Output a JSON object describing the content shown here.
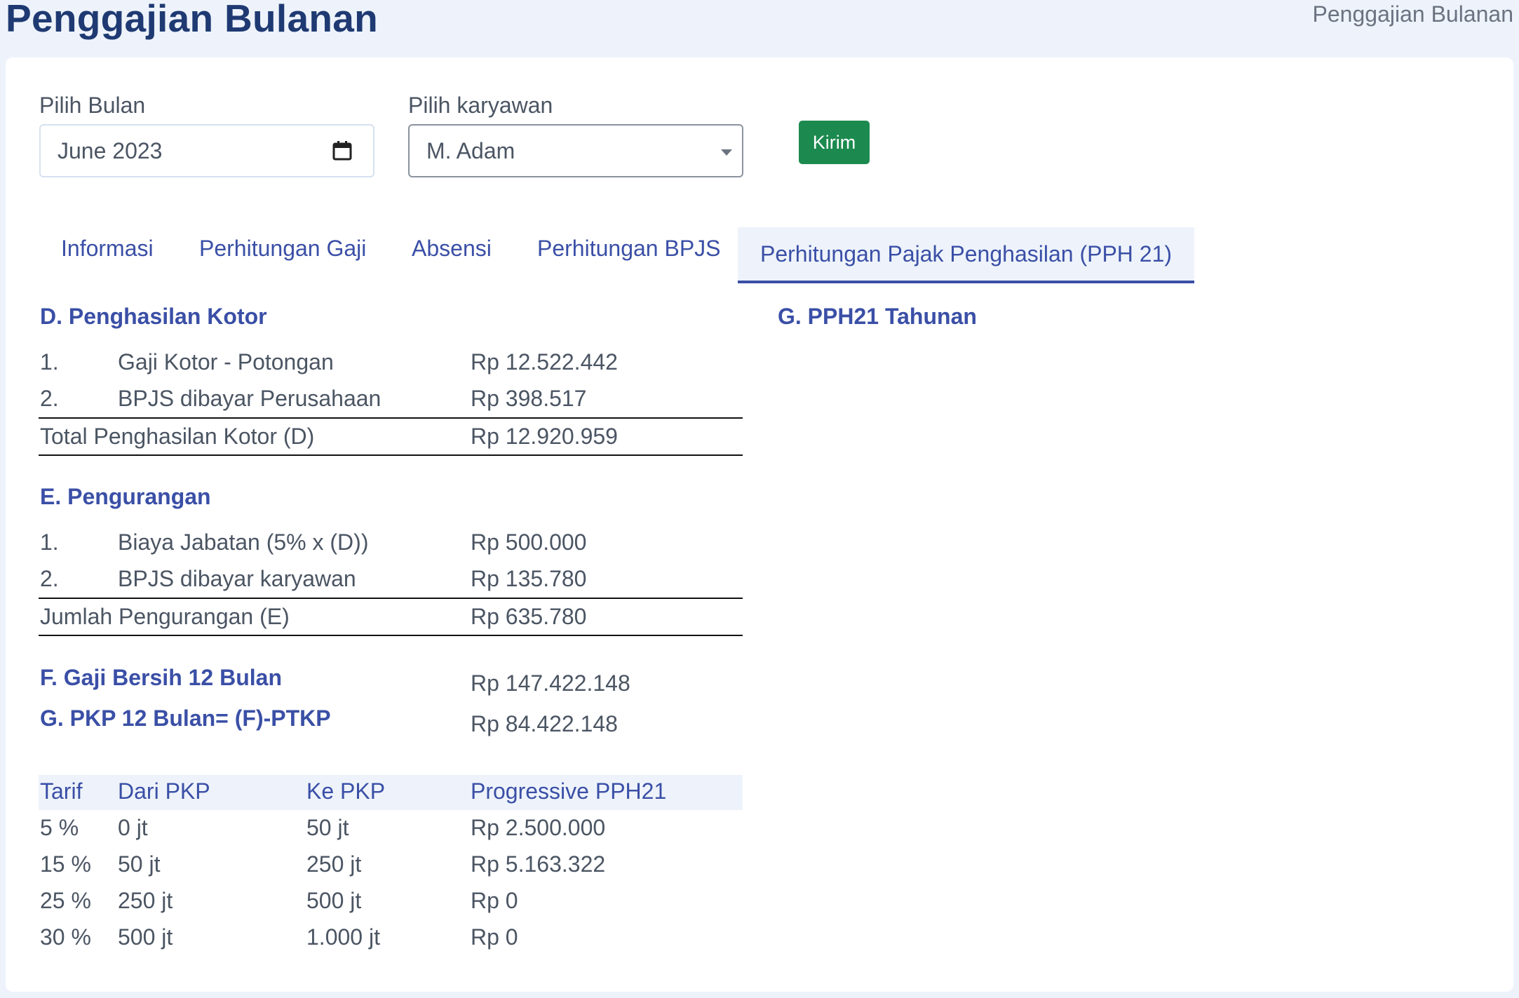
{
  "header": {
    "title": "Penggajian Bulanan",
    "breadcrumb": "Penggajian Bulanan"
  },
  "form": {
    "month_label": "Pilih Bulan",
    "month_value": "June 2023",
    "employee_label": "Pilih karyawan",
    "employee_value": "M. Adam",
    "submit_label": "Kirim"
  },
  "tabs": [
    {
      "label": "Informasi",
      "active": false
    },
    {
      "label": "Perhitungan Gaji",
      "active": false
    },
    {
      "label": "Absensi",
      "active": false
    },
    {
      "label": "Perhitungan BPJS",
      "active": false
    },
    {
      "label": "Perhitungan Pajak Penghasilan (PPH 21)",
      "active": true
    }
  ],
  "section_d": {
    "title": "D. Penghasilan Kotor",
    "rows": [
      {
        "no": "1.",
        "label": "Gaji Kotor - Potongan",
        "value": "Rp 12.522.442"
      },
      {
        "no": "2.",
        "label": "BPJS dibayar Perusahaan",
        "value": "Rp 398.517"
      }
    ],
    "total_label": "Total Penghasilan Kotor (D)",
    "total_value": "Rp 12.920.959"
  },
  "section_e": {
    "title": "E. Pengurangan",
    "rows": [
      {
        "no": "1.",
        "label": "Biaya Jabatan (5% x (D))",
        "value": "Rp 500.000"
      },
      {
        "no": "2.",
        "label": "BPJS dibayar karyawan",
        "value": "Rp 135.780"
      }
    ],
    "total_label": "Jumlah Pengurangan (E)",
    "total_value": "Rp 635.780"
  },
  "section_f": {
    "title": "F. Gaji Bersih 12 Bulan",
    "value": "Rp 147.422.148"
  },
  "section_g": {
    "title": "G. PKP 12 Bulan= (F)-PTKP",
    "value": "Rp 84.422.148"
  },
  "right_panel": {
    "title": "G. PPH21 Tahunan"
  },
  "tax_table": {
    "headers": [
      "Tarif",
      "Dari PKP",
      "Ke PKP",
      "Progressive PPH21"
    ],
    "rows": [
      [
        "5 %",
        "0 jt",
        "50 jt",
        "Rp 2.500.000"
      ],
      [
        "15 %",
        "50 jt",
        "250 jt",
        "Rp 5.163.322"
      ],
      [
        "25 %",
        "250 jt",
        "500 jt",
        "Rp 0"
      ],
      [
        "30 %",
        "500 jt",
        "1.000 jt",
        "Rp 0"
      ]
    ]
  },
  "colors": {
    "accent": "#3a4fa6",
    "title": "#1f3a72",
    "submit": "#1c8a4f",
    "background": "#eef3fb"
  }
}
